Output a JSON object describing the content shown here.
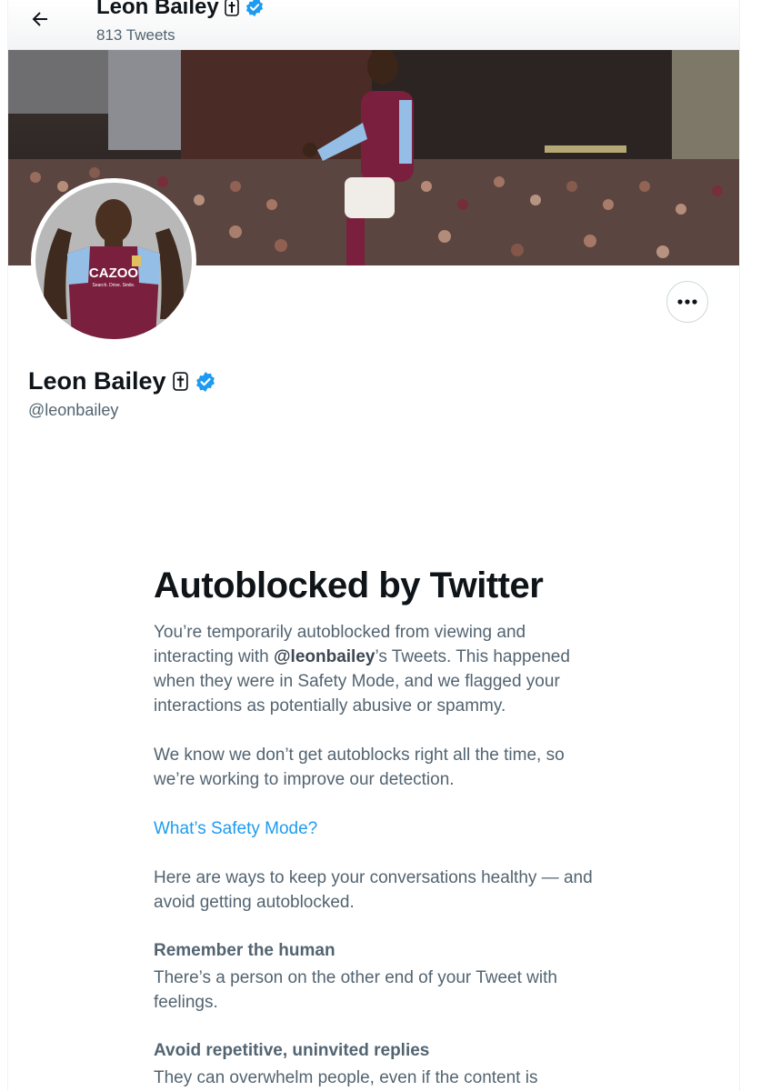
{
  "header": {
    "name": "Leon Bailey",
    "tweet_count": "813 Tweets"
  },
  "profile": {
    "name": "Leon Bailey",
    "handle": "@leonbailey",
    "verified": true,
    "name_emoji": "cross"
  },
  "banner": {
    "sponsor_text": "CAZOO",
    "sponsor_tagline": "Search. Drive. Smile."
  },
  "message": {
    "title": "Autoblocked by Twitter",
    "p1_before": "You’re temporarily autoblocked from viewing and interacting with ",
    "p1_handle": "@leonbailey",
    "p1_after": "’s Tweets. This happened when they were in Safety Mode, and we flagged your interactions as potentially abusive or spammy.",
    "p2": "We know we don’t get autoblocks right all the time, so we’re working to improve our detection.",
    "link": "What’s Safety Mode?",
    "p3": "Here are ways to keep your conversations healthy — and avoid getting autoblocked.",
    "h1": "Remember the human",
    "h1_text": "There’s a person on the other end of your Tweet with feelings.",
    "h2": "Avoid repetitive, uninvited replies",
    "h2_text": "They can overwhelm people, even if the content is"
  },
  "colors": {
    "accent": "#1d9bf0",
    "text": "#0f1419",
    "secondary": "#536471",
    "claret": "#7a1f3d",
    "sky_blue": "#94bee5"
  },
  "icons": [
    "arrow-left-icon",
    "verified-badge-icon",
    "cross-icon",
    "more-dots-icon"
  ]
}
